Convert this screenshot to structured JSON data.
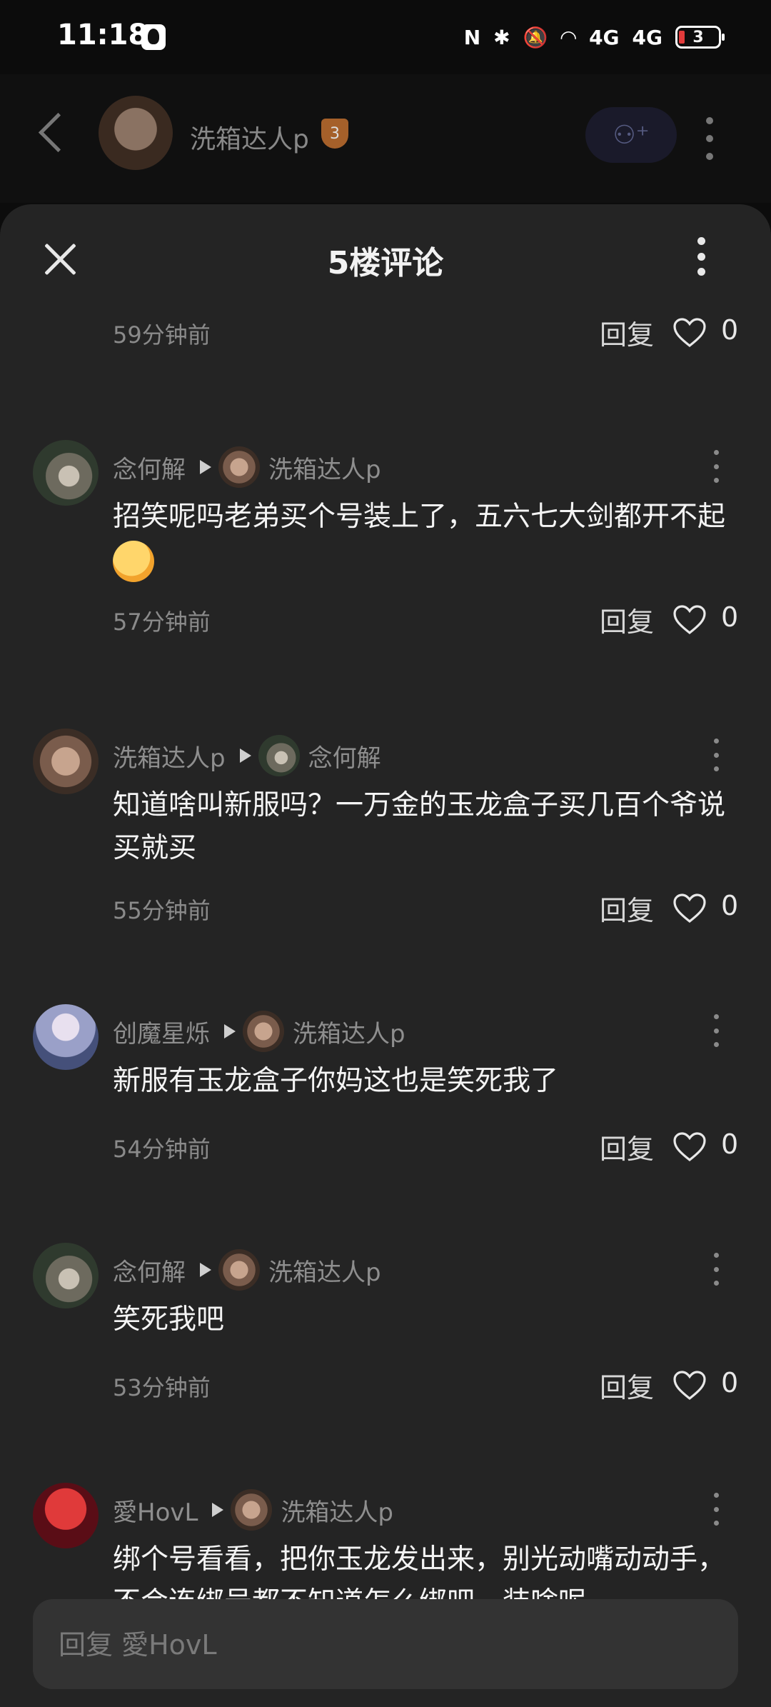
{
  "status_bar": {
    "time": "11:18",
    "nfc": "N",
    "signal_1": "4G",
    "signal_2": "4G",
    "battery": "3"
  },
  "top_bar": {
    "username": "洗箱达人p",
    "level": "3"
  },
  "sheet": {
    "title": "5楼评论"
  },
  "first_meta": {
    "time": "59分钟前",
    "reply_label": "回复",
    "likes": "0"
  },
  "comments": [
    {
      "user": "念何解",
      "reply_to": "洗箱达人p",
      "text": "招笑呢吗老弟买个号装上了，五六七大剑都开不起",
      "time": "57分钟前",
      "reply_label": "回复",
      "likes": "0"
    },
    {
      "user": "洗箱达人p",
      "reply_to": "念何解",
      "text": "知道啥叫新服吗？一万金的玉龙盒子买几百个爷说买就买",
      "time": "55分钟前",
      "reply_label": "回复",
      "likes": "0"
    },
    {
      "user": "创魔星烁",
      "reply_to": "洗箱达人p",
      "text": "新服有玉龙盒子你妈这也是笑死我了",
      "time": "54分钟前",
      "reply_label": "回复",
      "likes": "0"
    },
    {
      "user": "念何解",
      "reply_to": "洗箱达人p",
      "text": "笑死我吧",
      "time": "53分钟前",
      "reply_label": "回复",
      "likes": "0"
    },
    {
      "user": "愛HovL",
      "reply_to": "洗箱达人p",
      "text": "绑个号看看，把你玉龙发出来，别光动嘴动动手，不会连绑号都不知道怎么绑吧，装啥呢"
    }
  ],
  "input": {
    "placeholder": "回复 愛HovL"
  }
}
